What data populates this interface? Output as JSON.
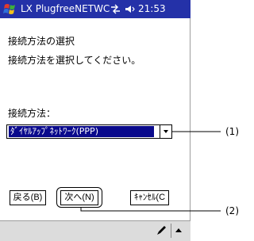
{
  "titlebar": {
    "start_icon": "windows-flag-icon",
    "title": "LX PlugfreeNETWC",
    "connectivity_icon": "connectivity-icon",
    "volume_icon": "speaker-icon",
    "time": "21:53"
  },
  "dialog": {
    "heading": "接続方法の選択",
    "instruction": "接続方法を選択してください。",
    "method_label": "接続方法：",
    "method_value": "ﾀﾞｲﾔﾙｱｯﾌﾟﾈｯﾄﾜｰｸ(PPP)",
    "dropdown_icon": "dropdown-arrow-icon"
  },
  "buttons": {
    "back": "戻る(B)",
    "next": "次へ(N)",
    "cancel": "ｷｬﾝｾﾙ(C"
  },
  "callouts": {
    "one": "(1)",
    "two": "(2)"
  },
  "taskbar": {
    "pen_icon": "pen-icon",
    "sip_icon": "up-arrow-icon"
  },
  "colors": {
    "titlebar": "#2431a8",
    "selection": "#0a0a8c",
    "taskbar": "#dcdcdc"
  }
}
